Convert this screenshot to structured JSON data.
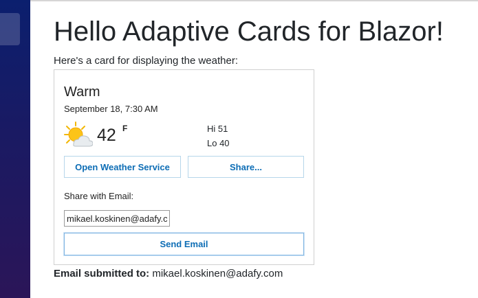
{
  "page": {
    "title": "Hello Adaptive Cards for Blazor!",
    "intro": "Here's a card for displaying the weather:"
  },
  "card": {
    "title": "Warm",
    "date": "September 18, 7:30 AM",
    "weather_icon": "partly-sunny-icon",
    "temperature": "42",
    "unit": "F",
    "hi": "Hi 51",
    "lo": "Lo 40",
    "buttons": {
      "open_weather": "Open Weather Service",
      "share": "Share..."
    },
    "share_label": "Share with Email:",
    "email_value": "mikael.koskinen@adafy.com",
    "send_button": "Send Email"
  },
  "result": {
    "label": "Email submitted to:",
    "email": "mikael.koskinen@adafy.com"
  },
  "colors": {
    "sidebar_top": "#0b1f6e",
    "sidebar_bottom": "#2b1558",
    "button_text": "#0d6db5",
    "button_border": "#b6d6ea"
  }
}
